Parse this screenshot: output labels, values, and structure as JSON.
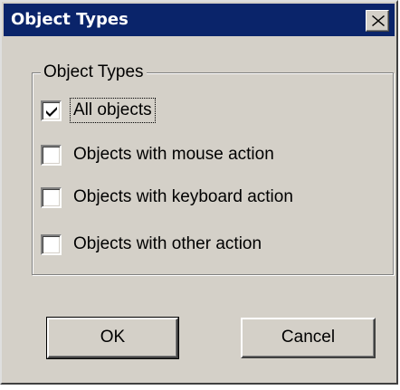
{
  "dialog": {
    "title": "Object Types",
    "close_icon": "close-x-icon"
  },
  "group": {
    "legend": "Object Types",
    "options": [
      {
        "label": "All objects",
        "checked": true
      },
      {
        "label": "Objects with mouse action",
        "checked": false
      },
      {
        "label": "Objects with keyboard action",
        "checked": false
      },
      {
        "label": "Objects with other action",
        "checked": false
      }
    ]
  },
  "buttons": {
    "ok_label": "OK",
    "cancel_label": "Cancel"
  },
  "colors": {
    "titlebar": "#0a246a",
    "face": "#d4d0c8"
  }
}
